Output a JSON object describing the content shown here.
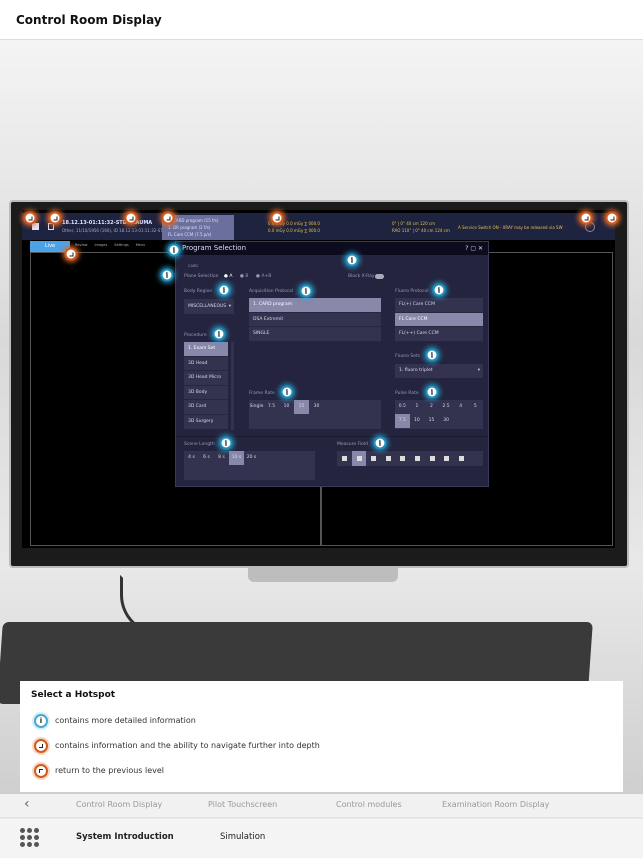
{
  "header": {
    "title": "Control Room Display"
  },
  "screen": {
    "topbar": {
      "patient_id": "18.12.13-01:11:32-STD-TRAUMA",
      "patient_info": "Other, 11/10/1956 (160), ID 18.12.13-01:11:32-STD-180000",
      "programs": [
        "1. CARD program (15 f/s)",
        "1. DR program (2 f/s)",
        "FL Care CCM (7.5 p/s)"
      ],
      "dose_rows": [
        "0.0 mGy   0.0 mGy   ∑ 000.0",
        "0.0 mGy   0.0 mGy   ∑ 000.0"
      ],
      "angles": [
        "0° |   0°  40 cm  120 cm",
        "RAO 110° |   0°  40 cm  124 cm"
      ],
      "message": "A Service Switch ON - XRAY may be released via SW"
    },
    "toolbar": {
      "live_label": "Live",
      "items": [
        "Review",
        "Images",
        "Settings",
        "Menu"
      ]
    }
  },
  "dialog": {
    "title": "Program Selection",
    "card_label": "CARD",
    "plane_selection": {
      "label": "Plane Selection",
      "options": [
        "A",
        "B",
        "A+B"
      ],
      "selected": "A"
    },
    "block_xray": {
      "label": "Block X-Ray",
      "on": true
    },
    "body_region": {
      "label": "Body Region",
      "value": "MISCELLANEOUS"
    },
    "procedure": {
      "label": "Procedure",
      "items": [
        "1. Exam Set",
        "3D Head",
        "3D Head Micro",
        "3D Body",
        "3D Card",
        "3D Surgery"
      ],
      "selected": "1. Exam Set"
    },
    "acquisition_protocol": {
      "label": "Acquisition Protocol",
      "items": [
        "1. CARD program",
        "DSA Extremit",
        "SINGLE"
      ],
      "selected": "1. CARD program"
    },
    "fluoro_protocol": {
      "label": "Fluoro Protocol",
      "items": [
        "FL(+) Care CCM",
        "FL Care CCM",
        "FL(++) Care CCM"
      ],
      "selected": "FL Care CCM"
    },
    "fluoro_sets": {
      "label": "Fluoro Sets",
      "value": "1. fluoro triplet"
    },
    "frame_rate": {
      "label": "Frame Rate",
      "options": [
        "Single",
        "7.5",
        "10",
        "15",
        "30"
      ],
      "selected": "15"
    },
    "pulse_rate": {
      "label": "Pulse Rate",
      "options": [
        "0.5",
        "1",
        "2",
        "2.5",
        "4",
        "5",
        "7.5",
        "10",
        "15",
        "30"
      ],
      "selected": "7.5"
    },
    "scene_length": {
      "label": "Scene Length",
      "options": [
        "4 s",
        "6 s",
        "8 s",
        "10 s",
        "20 s"
      ],
      "selected": "10 s"
    },
    "measure_field": {
      "label": "Measure Field",
      "count": 9,
      "selected_index": 1
    }
  },
  "legend": {
    "title": "Select a Hotspot",
    "items": [
      {
        "icon": "info-hotspot-icon",
        "text": "contains more detailed information"
      },
      {
        "icon": "navigate-hotspot-icon",
        "text": "contains information and the ability to navigate further into depth"
      },
      {
        "icon": "back-hotspot-icon",
        "text": "return to the previous level"
      }
    ]
  },
  "subnav": {
    "back_icon": "chevron-left-icon",
    "items": [
      "Control Room Display",
      "Pilot Touchscreen",
      "Control modules",
      "Examination Room Display"
    ]
  },
  "mainnav": {
    "menu_icon": "grid-icon",
    "items": [
      "System Introduction",
      "Simulation"
    ],
    "active": "System Introduction"
  },
  "colors": {
    "info": "#1e8fb8",
    "navigate": "#d25a1e",
    "dialog_bg": "#24243e",
    "live": "#4aa3e8"
  }
}
